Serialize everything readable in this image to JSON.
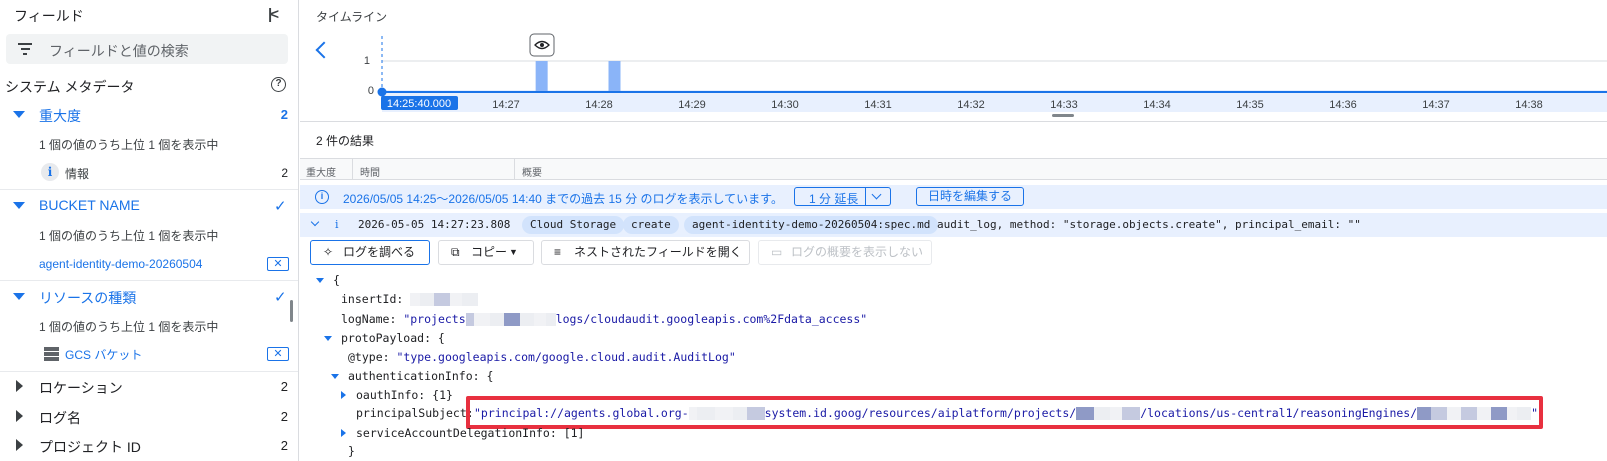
{
  "sidebar": {
    "title": "フィールド",
    "collapse_icon": "collapse-left-icon",
    "search_placeholder": "フィールドと値の検索",
    "section_title": "システム メタデータ",
    "groups": [
      {
        "title": "重大度",
        "count": "2",
        "note": "1 個の値のうち上位 1 個を表示中",
        "value": "情報",
        "value_count": "2"
      },
      {
        "title": "BUCKET NAME",
        "note": "1 個の値のうち上位 1 個を表示中",
        "value": "agent-identity-demo-20260504"
      },
      {
        "title": "リソースの種類",
        "note": "1 個の値のうち上位 1 個を表示中",
        "value": "GCS バケット"
      }
    ],
    "collapsed": [
      {
        "title": "ロケーション",
        "count": "2"
      },
      {
        "title": "ログ名",
        "count": "2"
      },
      {
        "title": "プロジェクト ID",
        "count": "2"
      }
    ]
  },
  "timeline": {
    "title": "タイムライン",
    "y_labels": [
      "1",
      "0"
    ],
    "start_label": "14:25:40.000",
    "ticks": [
      "14:27",
      "14:28",
      "14:29",
      "14:30",
      "14:31",
      "14:32",
      "14:33",
      "14:34",
      "14:35",
      "14:36",
      "14:37",
      "14:38"
    ],
    "bars": [
      {
        "time": "14:27:23",
        "count": 1
      },
      {
        "time": "14:28:10",
        "count": 1
      }
    ]
  },
  "results": {
    "count_label": "2 件の結果",
    "columns": [
      "重大度",
      "時間",
      "概要"
    ]
  },
  "banner": {
    "text": "2026/05/05 14:25～2026/05/05 14:40 までの過去 15 分 のログを表示しています。",
    "extend_label": "1 分 延長",
    "edit_label": "日時を編集する"
  },
  "log_entry": {
    "severity": "i",
    "timestamp": "2026-05-05 14:27:23.808",
    "chips": [
      "Cloud Storage",
      "create",
      "agent-identity-demo-20260504:spec.md"
    ],
    "summary": "audit_log, method: \"storage.objects.create\", principal_email: \"\""
  },
  "actions": {
    "explain": "ログを調べる",
    "copy": "コピー",
    "expand": "ネストされたフィールドを開く",
    "hide_summary": "ログの概要を表示しない"
  },
  "json": {
    "open_brace": "{",
    "insertId_key": "insertId:",
    "logName_key": "logName:",
    "logName_prefix": "\"projects",
    "logName_suffix": "logs/cloudaudit.googleapis.com%2Fdata_access\"",
    "protoPayload_key": "protoPayload: {",
    "type_key": "@type:",
    "type_val": "\"type.googleapis.com/google.cloud.audit.AuditLog\"",
    "auth_key": "authenticationInfo: {",
    "oauth": "oauthInfo: {1}",
    "principal_key": "principalSubject:",
    "principal_p1": "\"principal://agents.global.org-",
    "principal_p2": "system.id.goog/resources/aiplatform/projects/",
    "principal_p3": "/locations/us-central1/reasoningEngines/",
    "principal_end": "\"",
    "sad": "serviceAccountDelegationInfo: [1]",
    "close": "}"
  }
}
